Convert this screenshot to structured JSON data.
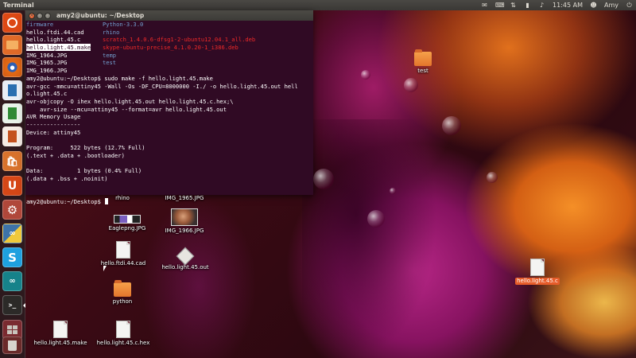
{
  "top_panel": {
    "app_title": "Terminal",
    "clock": "11:45 AM",
    "user": "Amy",
    "indicators": [
      "mail-icon",
      "keyboard-icon",
      "network-icon",
      "battery-icon",
      "volume-icon"
    ]
  },
  "launcher": {
    "items": [
      {
        "name": "dash-home",
        "icon": "ubuntu-logo-icon",
        "color": "#dd4814"
      },
      {
        "name": "files",
        "icon": "home-folder-icon",
        "color": "#e06a28"
      },
      {
        "name": "firefox",
        "icon": "firefox-icon",
        "color": "#d35b12"
      },
      {
        "name": "writer",
        "icon": "libreoffice-writer-icon",
        "color": "#2a6fb0"
      },
      {
        "name": "calc",
        "icon": "libreoffice-calc-icon",
        "color": "#2f8a34"
      },
      {
        "name": "impress",
        "icon": "libreoffice-impress-icon",
        "color": "#c4521f"
      },
      {
        "name": "software-center",
        "icon": "software-center-icon",
        "color": "#d8722c"
      },
      {
        "name": "ubuntu-one",
        "icon": "ubuntu-one-icon",
        "color": "#d64717"
      },
      {
        "name": "system-settings",
        "icon": "gear-icon",
        "color": "#b0473a"
      },
      {
        "name": "python",
        "icon": "python-icon",
        "color": "#3e73a8"
      },
      {
        "name": "skype",
        "icon": "skype-icon",
        "color": "#1ea0df"
      },
      {
        "name": "arduino",
        "icon": "arduino-icon",
        "color": "#16828a"
      },
      {
        "name": "terminal",
        "icon": "terminal-icon",
        "color": "#2c2a28"
      },
      {
        "name": "workspace-switcher",
        "icon": "workspace-icon",
        "color": "#7a2a30"
      },
      {
        "name": "trash",
        "icon": "trash-icon",
        "color": "#6a2a2a"
      }
    ]
  },
  "terminal": {
    "title": "amy2@ubuntu: ~/Desktop",
    "listing": [
      {
        "a": "firmware",
        "a_style": "blue",
        "b": "Python-3.3.0",
        "b_style": "blue"
      },
      {
        "a": "hello.ftdi.44.cad",
        "a_style": "plain",
        "b": "rhino",
        "b_style": "blue"
      },
      {
        "a": "hello.light.45.c",
        "a_style": "plain",
        "b": "scratch_1.4.0.6-dfsg1-2-ubuntu12.04.1_all.deb",
        "b_style": "red"
      },
      {
        "a": "hello.light.45.make",
        "a_style": "selected",
        "b": "skype-ubuntu-precise_4.1.0.20-1_i386.deb",
        "b_style": "red"
      },
      {
        "a": "IMG_1964.JPG",
        "a_style": "plain",
        "b": "temp",
        "b_style": "blue"
      },
      {
        "a": "IMG_1965.JPG",
        "a_style": "plain",
        "b": "test",
        "b_style": "blue"
      },
      {
        "a": "IMG_1966.JPG",
        "a_style": "plain",
        "b": "",
        "b_style": "plain"
      }
    ],
    "output": [
      "amy2@ubuntu:~/Desktop$ sudo make -f hello.light.45.make",
      "avr-gcc -mmcu=attiny45 -Wall -Os -DF_CPU=8000000 -I./ -o hello.light.45.out hell",
      "o.light.45.c",
      "avr-objcopy -O ihex hello.light.45.out hello.light.45.c.hex;\\",
      "    avr-size --mcu=attiny45 --format=avr hello.light.45.out",
      "AVR Memory Usage",
      "----------------",
      "Device: attiny45",
      "",
      "Program:     522 bytes (12.7% Full)",
      "(.text + .data + .bootloader)",
      "",
      "Data:          1 bytes (0.4% Full)",
      "(.data + .bss + .noinit)",
      "",
      "",
      "amy2@ubuntu:~/Desktop$ "
    ]
  },
  "desktop_icons": {
    "test": "test",
    "rhino": "rhino",
    "img_1965": "IMG_1965.JPG",
    "eaglepng": "Eaglepng.JPG",
    "img_1966": "IMG_1966.JPG",
    "hello_ftdi": "hello.ftdi.44.cad",
    "hello_out": "hello.light.45.out",
    "python": "python",
    "hello_make": "hello.light.45.make",
    "hello_hex": "hello.light.45.c.hex",
    "hello_c": "hello.light.45.c"
  }
}
